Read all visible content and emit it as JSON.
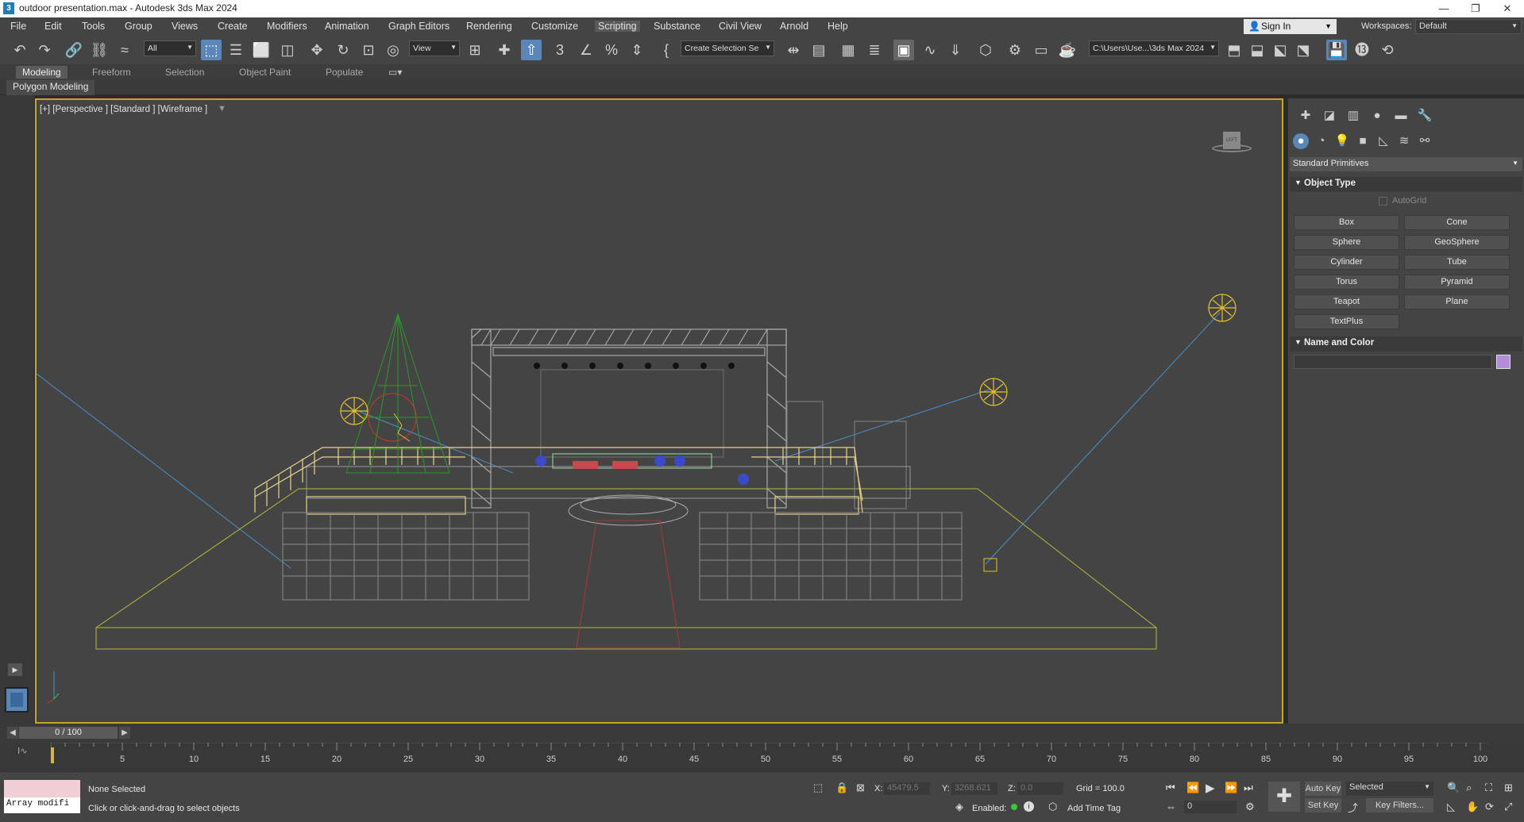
{
  "window": {
    "title": "outdoor presentation.max - Autodesk 3ds Max 2024"
  },
  "menu": [
    "File",
    "Edit",
    "Tools",
    "Group",
    "Views",
    "Create",
    "Modifiers",
    "Animation",
    "Graph Editors",
    "Rendering",
    "Customize",
    "Scripting",
    "Substance",
    "Civil View",
    "Arnold",
    "Help"
  ],
  "account": {
    "sign_in": "Sign In",
    "workspaces_label": "Workspaces:",
    "workspace": "Default"
  },
  "toolbar": {
    "filter": "All",
    "coord_system": "View",
    "selection_set": "Create Selection Se",
    "project_path": "C:\\Users\\Use...\\3ds Max 2024"
  },
  "ribbon": {
    "tabs": [
      "Modeling",
      "Freeform",
      "Selection",
      "Object Paint",
      "Populate"
    ],
    "panel": "Polygon Modeling"
  },
  "viewport": {
    "label": "[+] [Perspective ] [Standard ] [Wireframe ]",
    "viewcube_face": "LEFT"
  },
  "command_panel": {
    "category": "Standard Primitives",
    "object_type_title": "Object Type",
    "autogrid": "AutoGrid",
    "buttons": [
      "Box",
      "Cone",
      "Sphere",
      "GeoSphere",
      "Cylinder",
      "Tube",
      "Torus",
      "Pyramid",
      "Teapot",
      "Plane",
      "TextPlus"
    ],
    "name_color_title": "Name and Color",
    "object_color": "#b48cdc"
  },
  "timeline": {
    "frame": "0 / 100",
    "ticks": [
      "5",
      "10",
      "15",
      "20",
      "25",
      "30",
      "35",
      "40",
      "45",
      "50",
      "55",
      "60",
      "65",
      "70",
      "75",
      "80",
      "85",
      "90",
      "95",
      "100"
    ]
  },
  "status": {
    "script_field": "Array modifi",
    "selection": "None Selected",
    "prompt": "Click or click-and-drag to select objects",
    "x_label": "X:",
    "x_value": "45479.5",
    "y_label": "Y:",
    "y_value": "3268.621",
    "z_label": "Z:",
    "z_value": "0.0",
    "grid": "Grid = 100.0",
    "enabled": "Enabled:",
    "add_time_tag": "Add Time Tag",
    "auto_key": "Auto Key",
    "set_key": "Set Key",
    "key_mode": "Selected",
    "key_filters": "Key Filters...",
    "current_frame": "0"
  }
}
